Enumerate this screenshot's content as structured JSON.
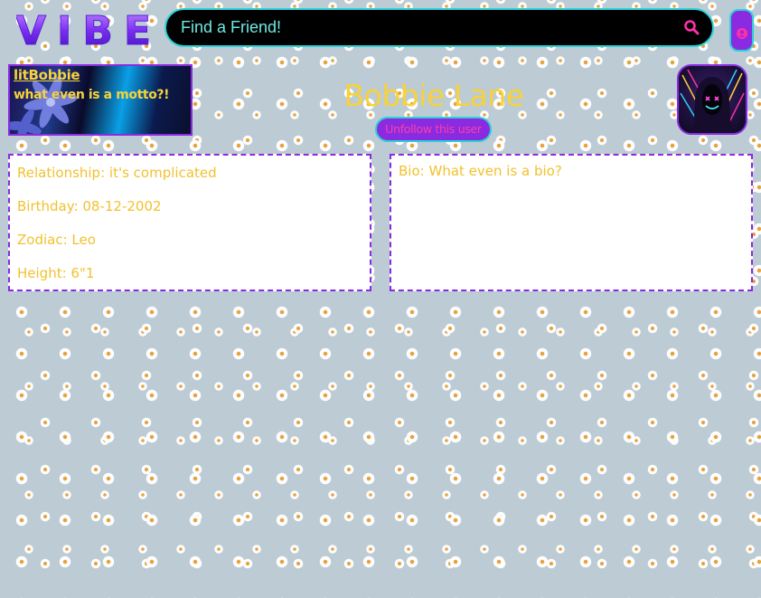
{
  "header": {
    "logo_text": "VIBE",
    "search": {
      "placeholder": "Find a Friend!",
      "value": ""
    },
    "search_icon": "search-icon",
    "account_icon": "user-circle-icon"
  },
  "profile": {
    "username": "litBobbie",
    "motto": "what even is a motto?!",
    "display_name": "Bobbie Lane",
    "follow_button_label": "Unfollow this user",
    "avatar_icon": "neon-hooded-figure-avatar"
  },
  "details": [
    {
      "label": "Relationship:",
      "value": "it's complicated"
    },
    {
      "label": "Birthday:",
      "value": "08-12-2002"
    },
    {
      "label": "Zodiac:",
      "value": "Leo"
    },
    {
      "label": "Height:",
      "value": "6\"1"
    }
  ],
  "bio": {
    "label": "Bio:",
    "text": "What even is a bio?"
  },
  "colors": {
    "accent_purple": "#8a2be2",
    "accent_cyan": "#2ad1d6",
    "text_gold": "#f7d23a",
    "button_text_pink": "#ff3ea5",
    "background": "#bccbd4"
  }
}
